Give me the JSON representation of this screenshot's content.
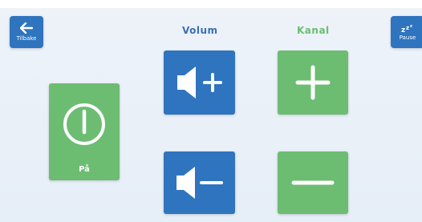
{
  "back": {
    "label": "Tilbake",
    "icon": "arrow-left-icon"
  },
  "pause": {
    "label": "Pause",
    "icon": "sleep-zzz-icon"
  },
  "headings": {
    "volume": "Volum",
    "channel": "Kanal"
  },
  "power": {
    "label": "På",
    "icon": "power-icon"
  },
  "icons": {
    "volume_up": "speaker-plus-icon",
    "volume_down": "speaker-minus-icon",
    "channel_up": "plus-icon",
    "channel_down": "minus-icon"
  },
  "colors": {
    "blue": "#2f74bf",
    "green": "#6cbd72",
    "volume_heading": "#3a6fb5",
    "channel_heading": "#6cbd72"
  }
}
